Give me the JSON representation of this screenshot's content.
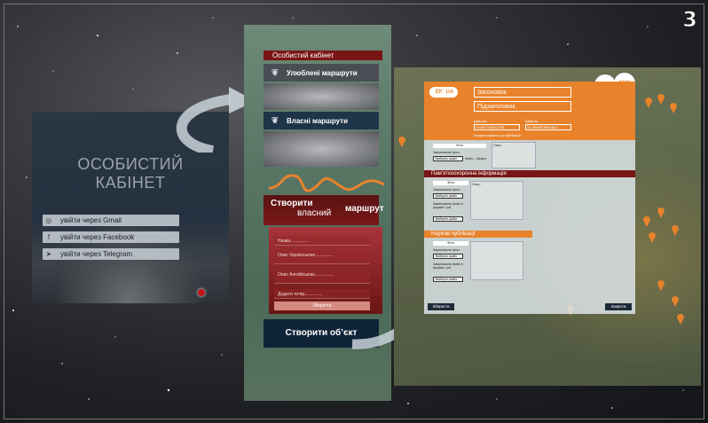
{
  "page_number": "3",
  "login": {
    "title_line1": "ОСОБИСТИЙ",
    "title_line2": "КАБІНЕТ",
    "buttons": [
      {
        "label": "увійти через Gmail",
        "icon": "gmail-icon",
        "glyph": "◎"
      },
      {
        "label": "увійти через Facebook",
        "icon": "facebook-icon",
        "glyph": "f"
      },
      {
        "label": "увійти через Telegram",
        "icon": "telegram-icon",
        "glyph": "➤"
      }
    ]
  },
  "cabinet": {
    "header": "Особистий кабінет",
    "favorite_routes": "Улюблені маршрути",
    "own_routes": "Власні маршрути",
    "create_route": {
      "line1": "Створити",
      "line2": "власний",
      "line3": "маршрут"
    },
    "form": {
      "name": "Назва...............",
      "desc_ua": "Опис Українською...............",
      "desc_en": "Опис Англійською...............",
      "add_point": "Додати точку...............",
      "save": "Зберегти",
      "recommend": "Запропонувати до публікації на мапі"
    },
    "create_object": "Створити об’єкт"
  },
  "object_form": {
    "lang_a": "EN",
    "lang_b": "UA",
    "title": "Заголовок",
    "subtitle": "Підзаголовок",
    "lat_label": "Довгота",
    "lon_label": "Широта",
    "lat_value": "49.687703013726",
    "lon_value": "24.3659879842812",
    "recommend": "Запропонувати до публікації",
    "photo_label": "Фото",
    "upload_photo_label": "Завантажити фото",
    "choose_file": "Виберіть файл",
    "file_hint": "Файл... обрано",
    "caption_hint": "Опис...",
    "monument_section": "Пам’яткоохоронна інформація",
    "upload_pdf_label": "Завантажити файл в форматі .pdf",
    "science_section": "Наукові публікації",
    "save": "Зберегти",
    "back": "Закрити",
    "logo_360": "360°"
  },
  "colors": {
    "accent_orange": "#e8832c",
    "dark_red": "#7a1515",
    "navy": "#0f2338"
  }
}
